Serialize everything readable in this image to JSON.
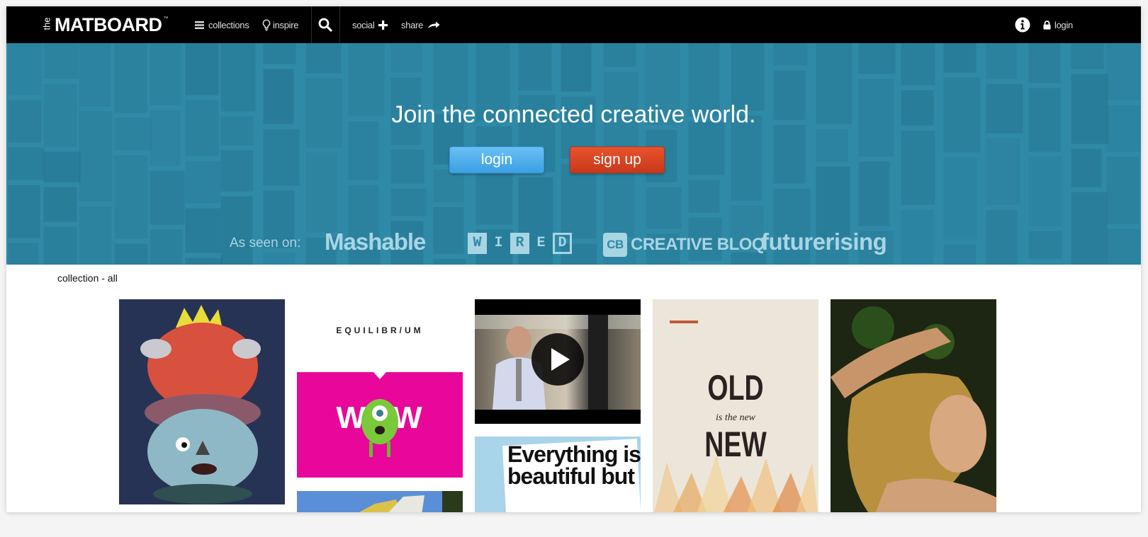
{
  "nav": {
    "logo_prefix": "the",
    "logo_main": "MATBOARD",
    "logo_tm": "™",
    "collections_label": "collections",
    "inspire_label": "inspire",
    "social_label": "social",
    "share_label": "share",
    "login_label": "login",
    "icons": {
      "collections": "hamburger-icon",
      "inspire": "lightbulb-icon",
      "search": "search-icon",
      "social": "plus-icon",
      "share": "arrow-right-icon",
      "info": "info-icon",
      "login": "lock-icon"
    }
  },
  "hero": {
    "headline": "Join the connected creative world.",
    "login_button": "login",
    "signup_button": "sign up",
    "as_seen_on_label": "As seen on:",
    "press": {
      "mashable": "Mashable",
      "wired_letters": [
        "W",
        "I",
        "R",
        "E",
        "D"
      ],
      "creativebloq_badge": "CB",
      "creativebloq": "CREATIVE BLOQ",
      "futurerising": "futurerising"
    },
    "colors": {
      "background": "#2f8aa8",
      "login_button": "#4fb1ee",
      "signup_button": "#d9441f"
    }
  },
  "content": {
    "collection_label": "collection - all",
    "cards": [
      {
        "name": "crowned-monster-illustration"
      },
      {
        "name": "equilibrium-poster",
        "text": "EQUILIBR/UM"
      },
      {
        "name": "wow-monster-poster",
        "text": "WOW"
      },
      {
        "name": "sky-photo"
      },
      {
        "name": "video-thumbnail",
        "has_play_button": true
      },
      {
        "name": "everything-is-beautiful-poster",
        "text": "Everything is beautiful but"
      },
      {
        "name": "old-is-the-new-new-poster",
        "text_top": "OLD",
        "text_mid": "is the new",
        "text_bottom": "NEW"
      },
      {
        "name": "woman-portrait-photo"
      }
    ]
  }
}
